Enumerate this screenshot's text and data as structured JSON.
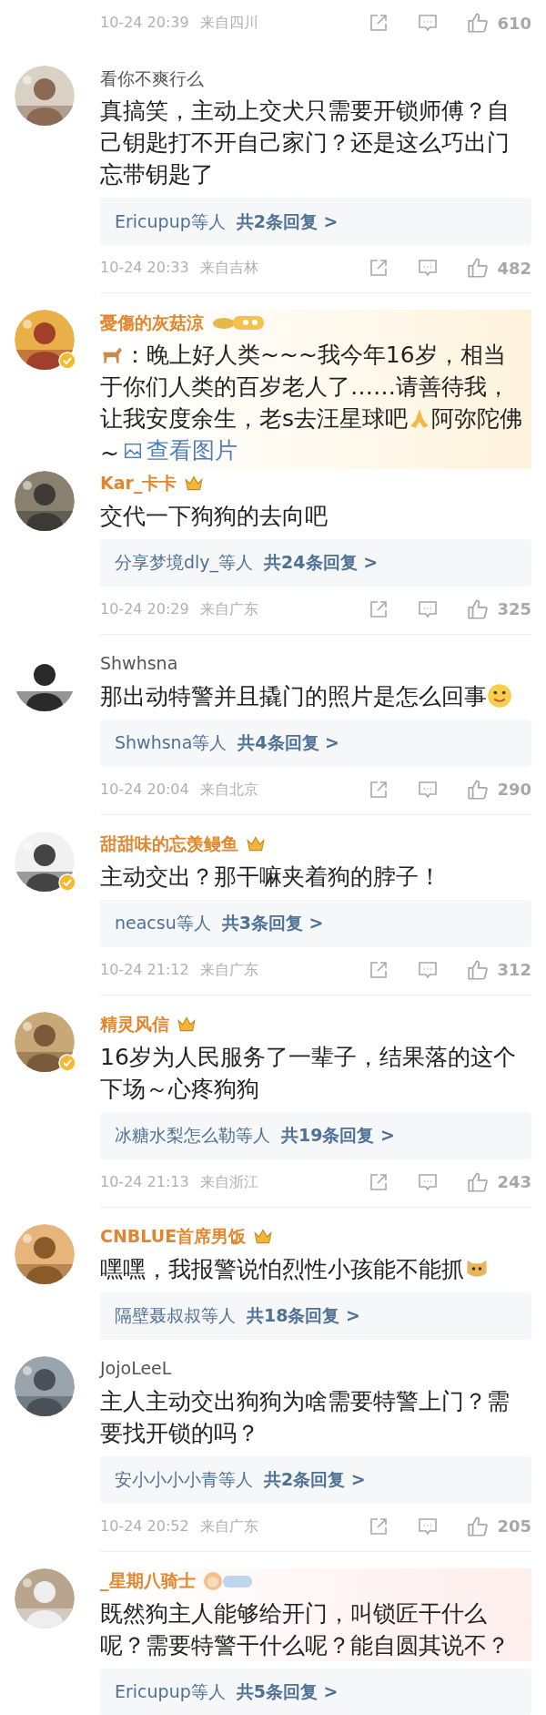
{
  "top_meta": {
    "time": "10-24 20:39",
    "location": "来自四川",
    "likes": "610"
  },
  "comments": [
    {
      "name": "看你不爽行么",
      "vip": false,
      "verified": false,
      "body": [
        {
          "kind": "text",
          "text": "真搞笑，主动上交犬只需要开锁师傅？自己钥匙打不开自己家门？还是这么巧出门忘带钥匙了"
        }
      ],
      "replies": {
        "from": "Ericupup等人",
        "total": "共2条回复 >"
      },
      "meta": {
        "time": "10-24 20:33",
        "location": "来自吉林",
        "likes": "482"
      }
    },
    {
      "name": "憂傷的灰菇涼",
      "vip": true,
      "badge": {
        "kind": "lizard"
      },
      "verified": true,
      "highlight": {
        "kind": "gold"
      },
      "body": [
        {
          "kind": "dog"
        },
        {
          "kind": "text",
          "text": "：晚上好人类~~~我今年16岁，相当于你们人类的百岁老人了……请善待我，让我安度余生，老s去汪星球吧"
        },
        {
          "kind": "pray"
        },
        {
          "kind": "text",
          "text": "阿弥陀佛~"
        },
        {
          "kind": "link",
          "text": "查看图片"
        }
      ]
    },
    {
      "name": "Kar_卡卡",
      "vip": true,
      "badge": {
        "kind": "crown"
      },
      "verified": false,
      "body": [
        {
          "kind": "text",
          "text": "交代一下狗狗的去向吧"
        }
      ],
      "replies": {
        "from": "分享梦境dly_等人",
        "total": "共24条回复 >"
      },
      "meta": {
        "time": "10-24 20:29",
        "location": "来自广东",
        "likes": "325"
      }
    },
    {
      "name": "Shwhsna",
      "vip": false,
      "verified": false,
      "body": [
        {
          "kind": "text",
          "text": "那出动特警并且撬门的照片是怎么回事"
        },
        {
          "kind": "smile"
        }
      ],
      "replies": {
        "from": "Shwhsna等人",
        "total": "共4条回复 >"
      },
      "meta": {
        "time": "10-24 20:04",
        "location": "来自北京",
        "likes": "290"
      }
    },
    {
      "name": "甜甜味的忘羡鳗鱼",
      "vip": true,
      "badge": {
        "kind": "crown"
      },
      "verified": true,
      "body": [
        {
          "kind": "text",
          "text": "主动交出？那干嘛夹着狗的脖子！"
        }
      ],
      "replies": {
        "from": "neacsu等人",
        "total": "共3条回复 >"
      },
      "meta": {
        "time": "10-24 21:12",
        "location": "来自广东",
        "likes": "312"
      }
    },
    {
      "name": "精灵风信",
      "vip": true,
      "badge": {
        "kind": "crown"
      },
      "verified": true,
      "body": [
        {
          "kind": "text",
          "text": "16岁为人民服务了一辈子，结果落的这个下场～心疼狗狗"
        }
      ],
      "replies": {
        "from": "冰糖水梨怎么勒等人",
        "total": "共19条回复 >"
      },
      "meta": {
        "time": "10-24 21:13",
        "location": "来自浙江",
        "likes": "243"
      }
    },
    {
      "name": "CNBLUE首席男饭",
      "vip": true,
      "badge": {
        "kind": "crown"
      },
      "verified": false,
      "body": [
        {
          "kind": "text",
          "text": "嘿嘿，我报警说怕烈性小孩能不能抓"
        },
        {
          "kind": "doge"
        }
      ],
      "replies": {
        "from": "隔壁聂叔叔等人",
        "total": "共18条回复 >"
      }
    },
    {
      "name": "JojoLeeL",
      "vip": false,
      "verified": false,
      "body": [
        {
          "kind": "text",
          "text": "主人主动交出狗狗为啥需要特警上门？需要找开锁的吗？"
        }
      ],
      "replies": {
        "from": "安小小小小青等人",
        "total": "共2条回复 >"
      },
      "meta": {
        "time": "10-24 20:52",
        "location": "来自广东",
        "likes": "205"
      }
    },
    {
      "name": "_星期八骑士",
      "vip": true,
      "badge": {
        "kind": "level"
      },
      "verified": false,
      "highlight": {
        "kind": "pink"
      },
      "body": [
        {
          "kind": "text",
          "text": "既然狗主人能够给开门，叫锁匠干什么呢？需要特警干什么呢？能自圆其说不？"
        }
      ],
      "replies": {
        "from": "Ericupup等人",
        "total": "共5条回复 >"
      }
    }
  ]
}
